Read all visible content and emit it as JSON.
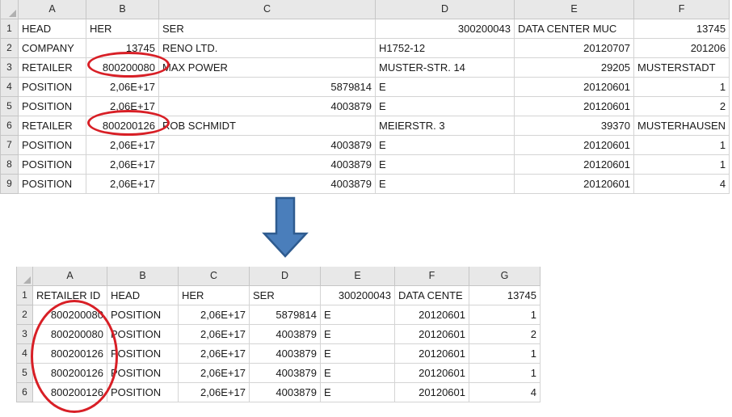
{
  "doc": {
    "title": "Spreadsheet transformation illustration",
    "accent_red": "#d81f26",
    "arrow_fill": "#4a7ebb",
    "arrow_stroke": "#2e5b8f"
  },
  "arrow": {
    "name": "down-arrow",
    "direction": "down"
  },
  "top_sheet": {
    "name": "top-spreadsheet",
    "corner_label": "",
    "columns": [
      "A",
      "B",
      "C",
      "D",
      "E",
      "F"
    ],
    "row_numbers": [
      "1",
      "2",
      "3",
      "4",
      "5",
      "6",
      "7",
      "8",
      "9"
    ],
    "rows": [
      [
        "HEAD",
        "HER",
        "SER",
        "300200043",
        "DATA CENTER MUC",
        "13745"
      ],
      [
        "COMPANY",
        "13745",
        "RENO LTD.",
        "H1752-12",
        "20120707",
        "201206"
      ],
      [
        "RETAILER",
        "800200080",
        "MAX POWER",
        "MUSTER-STR. 14",
        "29205",
        "MUSTERSTADT"
      ],
      [
        "POSITION",
        "2,06E+17",
        "5879814",
        "E",
        "20120601",
        "1"
      ],
      [
        "POSITION",
        "2,06E+17",
        "4003879",
        "E",
        "20120601",
        "2"
      ],
      [
        "RETAILER",
        "800200126",
        "ROB SCHMIDT",
        "MEIERSTR. 3",
        "39370",
        "MUSTERHAUSEN"
      ],
      [
        "POSITION",
        "2,06E+17",
        "4003879",
        "E",
        "20120601",
        "1"
      ],
      [
        "POSITION",
        "2,06E+17",
        "4003879",
        "E",
        "20120601",
        "1"
      ],
      [
        "POSITION",
        "2,06E+17",
        "4003879",
        "E",
        "20120601",
        "4"
      ]
    ],
    "alignments": [
      [
        "txt",
        "txt",
        "txt",
        "num",
        "txt",
        "num"
      ],
      [
        "txt",
        "num",
        "txt",
        "txt",
        "num",
        "num"
      ],
      [
        "txt",
        "num",
        "txt",
        "txt",
        "num",
        "txt"
      ],
      [
        "txt",
        "num",
        "num",
        "txt",
        "num",
        "num"
      ],
      [
        "txt",
        "num",
        "num",
        "txt",
        "num",
        "num"
      ],
      [
        "txt",
        "num",
        "txt",
        "txt",
        "num",
        "txt"
      ],
      [
        "txt",
        "num",
        "num",
        "txt",
        "num",
        "num"
      ],
      [
        "txt",
        "num",
        "num",
        "txt",
        "num",
        "num"
      ],
      [
        "txt",
        "num",
        "num",
        "txt",
        "num",
        "num"
      ]
    ]
  },
  "bottom_sheet": {
    "name": "bottom-spreadsheet",
    "corner_label": "",
    "columns": [
      "A",
      "B",
      "C",
      "D",
      "E",
      "F",
      "G"
    ],
    "row_numbers": [
      "1",
      "2",
      "3",
      "4",
      "5",
      "6"
    ],
    "rows": [
      [
        "RETAILER ID",
        "HEAD",
        "HER",
        "SER",
        "300200043",
        "DATA CENTE",
        "13745"
      ],
      [
        "800200080",
        "POSITION",
        "2,06E+17",
        "5879814",
        "E",
        "20120601",
        "1"
      ],
      [
        "800200080",
        "POSITION",
        "2,06E+17",
        "4003879",
        "E",
        "20120601",
        "2"
      ],
      [
        "800200126",
        "POSITION",
        "2,06E+17",
        "4003879",
        "E",
        "20120601",
        "1"
      ],
      [
        "800200126",
        "POSITION",
        "2,06E+17",
        "4003879",
        "E",
        "20120601",
        "1"
      ],
      [
        "800200126",
        "POSITION",
        "2,06E+17",
        "4003879",
        "E",
        "20120601",
        "4"
      ]
    ],
    "alignments": [
      [
        "txt",
        "txt",
        "txt",
        "txt",
        "num",
        "txt",
        "num"
      ],
      [
        "num",
        "txt",
        "num",
        "num",
        "txt",
        "num",
        "num"
      ],
      [
        "num",
        "txt",
        "num",
        "num",
        "txt",
        "num",
        "num"
      ],
      [
        "num",
        "txt",
        "num",
        "num",
        "txt",
        "num",
        "num"
      ],
      [
        "num",
        "txt",
        "num",
        "num",
        "txt",
        "num",
        "num"
      ],
      [
        "num",
        "txt",
        "num",
        "num",
        "txt",
        "num",
        "num"
      ]
    ]
  },
  "annotations": [
    {
      "name": "highlight-ellipse-retailer-id-row3",
      "target": "top_sheet.rows.2.1"
    },
    {
      "name": "highlight-ellipse-retailer-id-row6",
      "target": "top_sheet.rows.5.1"
    },
    {
      "name": "highlight-ellipse-retailer-id-column",
      "target": "bottom_sheet.column.A"
    }
  ]
}
